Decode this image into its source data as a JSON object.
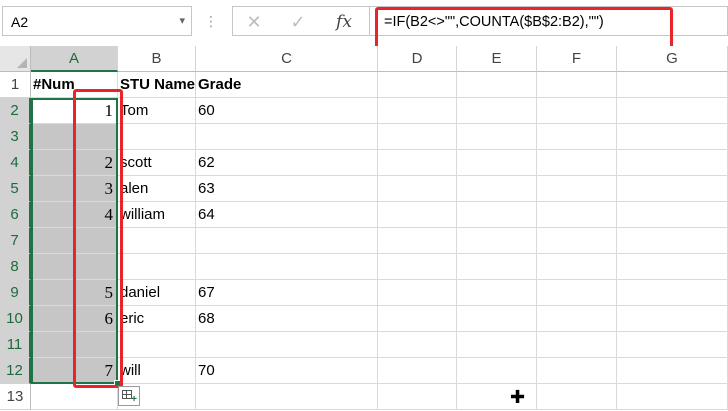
{
  "formula_bar": {
    "name_box": "A2",
    "cancel_glyph": "✕",
    "enter_glyph": "✓",
    "fx_label": "fx",
    "formula": "=IF(B2<>\"\",COUNTA($B$2:B2),\"\")"
  },
  "columns": [
    "A",
    "B",
    "C",
    "D",
    "E",
    "F",
    "G"
  ],
  "rows": [
    "1",
    "2",
    "3",
    "4",
    "5",
    "6",
    "7",
    "8",
    "9",
    "10",
    "11",
    "12",
    "13"
  ],
  "cells": {
    "A1": "#Num",
    "B1": "STU Name",
    "C1": "Grade",
    "A2": "1",
    "B2": "Tom",
    "C2": "60",
    "A4": "2",
    "B4": "scott",
    "C4": "62",
    "A5": "3",
    "B5": "alen",
    "C5": "63",
    "A6": "4",
    "B6": "william",
    "C6": "64",
    "A9": "5",
    "B9": "daniel",
    "C9": "67",
    "A10": "6",
    "B10": "eric",
    "C10": "68",
    "A12": "7",
    "B12": "will",
    "C12": "70"
  },
  "selection": {
    "range": "A2:A12",
    "active_cell": "A2"
  },
  "colors": {
    "accent_green": "#217346",
    "highlight_red": "#e8262a",
    "selected_fill": "#c6c6c6"
  },
  "icons": [
    "dropdown-arrow-icon",
    "cancel-icon",
    "enter-icon",
    "fx-icon",
    "quick-analysis-icon",
    "cell-cursor-icon"
  ]
}
